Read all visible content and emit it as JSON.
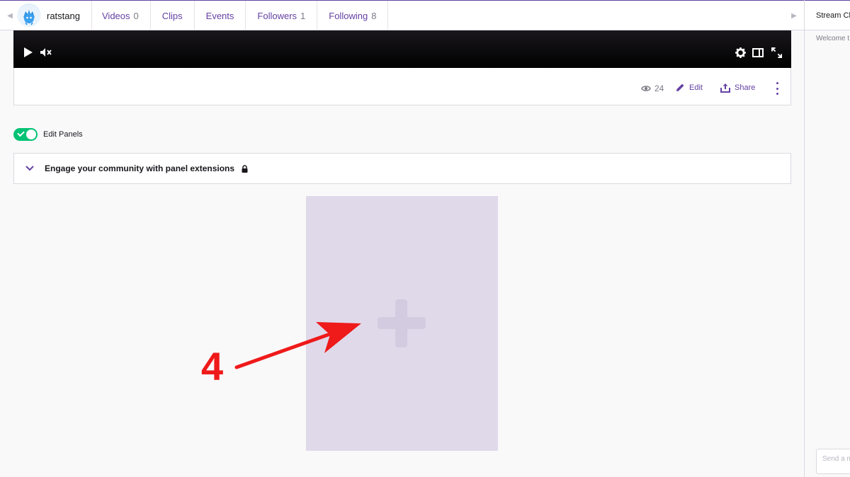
{
  "channel": {
    "name": "ratstang"
  },
  "tabs": [
    {
      "label": "Videos",
      "count": "0"
    },
    {
      "label": "Clips",
      "count": ""
    },
    {
      "label": "Events",
      "count": ""
    },
    {
      "label": "Followers",
      "count": "1"
    },
    {
      "label": "Following",
      "count": "8"
    }
  ],
  "chat": {
    "header": "Stream Ch",
    "welcome": "Welcome t",
    "input_placeholder": "Send a m"
  },
  "player": {
    "icons": [
      "play-icon",
      "mute-icon",
      "settings-icon",
      "theatre-mode-icon",
      "fullscreen-icon"
    ]
  },
  "info": {
    "views": "24",
    "edit_label": "Edit",
    "share_label": "Share"
  },
  "panels": {
    "toggle_label": "Edit Panels",
    "toggle_on": true,
    "extensions_title": "Engage your community with panel extensions"
  },
  "annotation": {
    "number": "4"
  },
  "colors": {
    "accent": "#6441a4",
    "toggle_on": "#00c274",
    "panel_placeholder": "#e0d9ea",
    "annotation": "#ef1a1a"
  }
}
